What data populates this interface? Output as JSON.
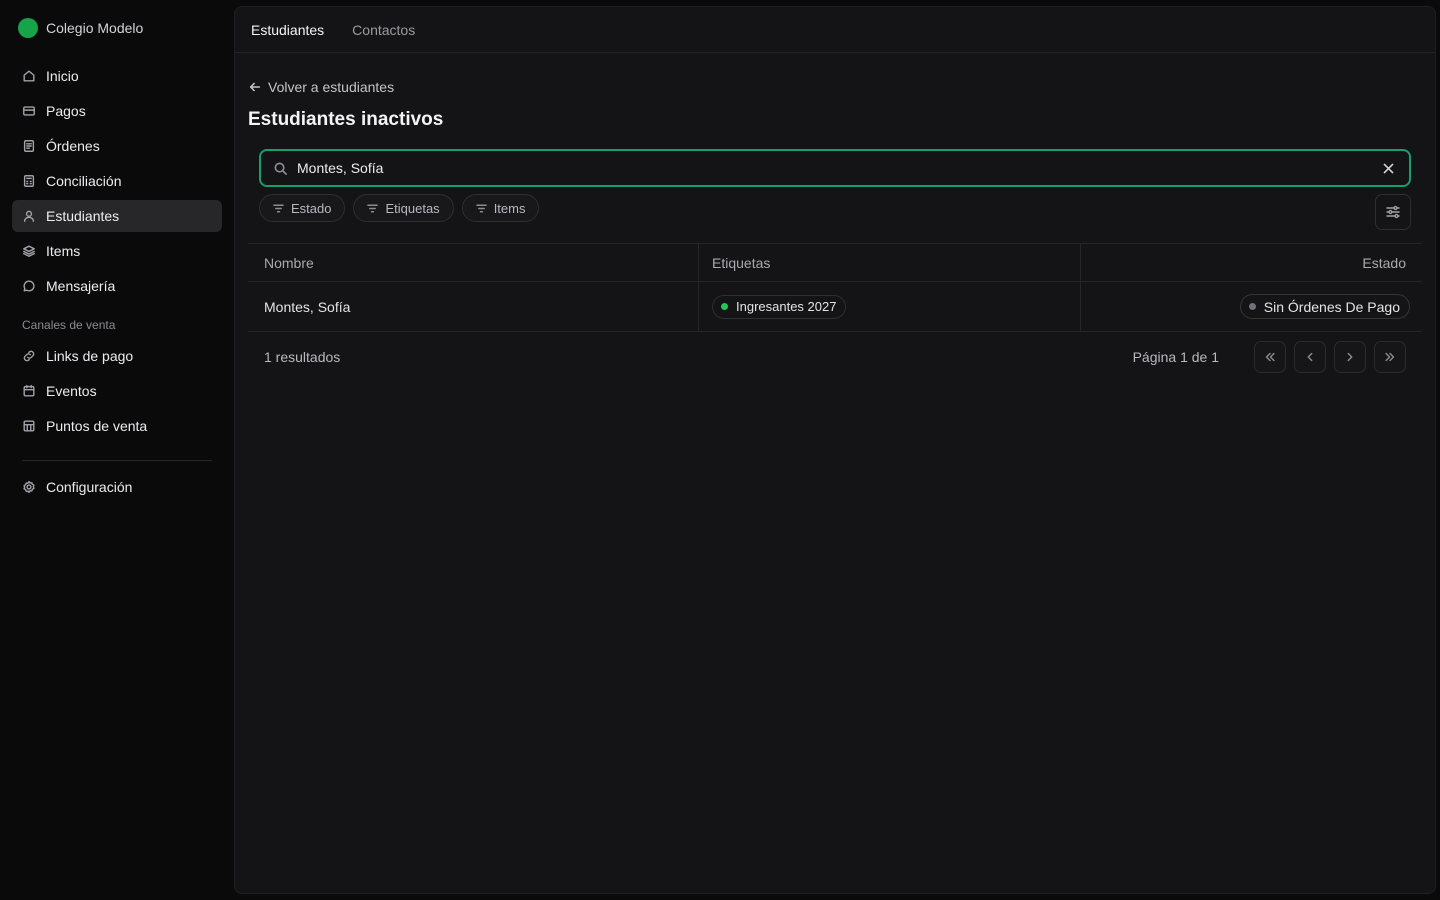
{
  "brand": {
    "name": "Colegio Modelo",
    "logo_color": "#16a34a"
  },
  "sidebar": {
    "items": [
      {
        "label": "Inicio",
        "icon": "home-icon"
      },
      {
        "label": "Pagos",
        "icon": "credit-card-icon"
      },
      {
        "label": "Órdenes",
        "icon": "receipt-icon"
      },
      {
        "label": "Conciliación",
        "icon": "calculator-icon"
      },
      {
        "label": "Estudiantes",
        "icon": "user-icon",
        "active": true
      },
      {
        "label": "Items",
        "icon": "layers-icon"
      },
      {
        "label": "Mensajería",
        "icon": "chat-icon"
      }
    ],
    "section_label": "Canales de venta",
    "channels": [
      {
        "label": "Links de pago",
        "icon": "link-icon"
      },
      {
        "label": "Eventos",
        "icon": "calendar-icon"
      },
      {
        "label": "Puntos de venta",
        "icon": "store-icon"
      }
    ],
    "settings": {
      "label": "Configuración",
      "icon": "gear-icon"
    }
  },
  "tabs": [
    {
      "label": "Estudiantes",
      "active": true
    },
    {
      "label": "Contactos",
      "active": false
    }
  ],
  "back_link": "Volver a estudiantes",
  "page_title": "Estudiantes inactivos",
  "search": {
    "value": "Montes, Sofía",
    "accent": "#15a06a"
  },
  "filters": [
    "Estado",
    "Etiquetas",
    "Items"
  ],
  "table": {
    "headers": [
      "Nombre",
      "Etiquetas",
      "Estado"
    ],
    "rows": [
      {
        "name": "Montes, Sofía",
        "tag": "Ingresantes 2027",
        "tag_color": "#22c55e",
        "status": "Sin Órdenes De Pago",
        "status_color": "#71717a"
      }
    ]
  },
  "footer": {
    "results": "1 resultados",
    "page_info": "Página 1 de 1"
  }
}
